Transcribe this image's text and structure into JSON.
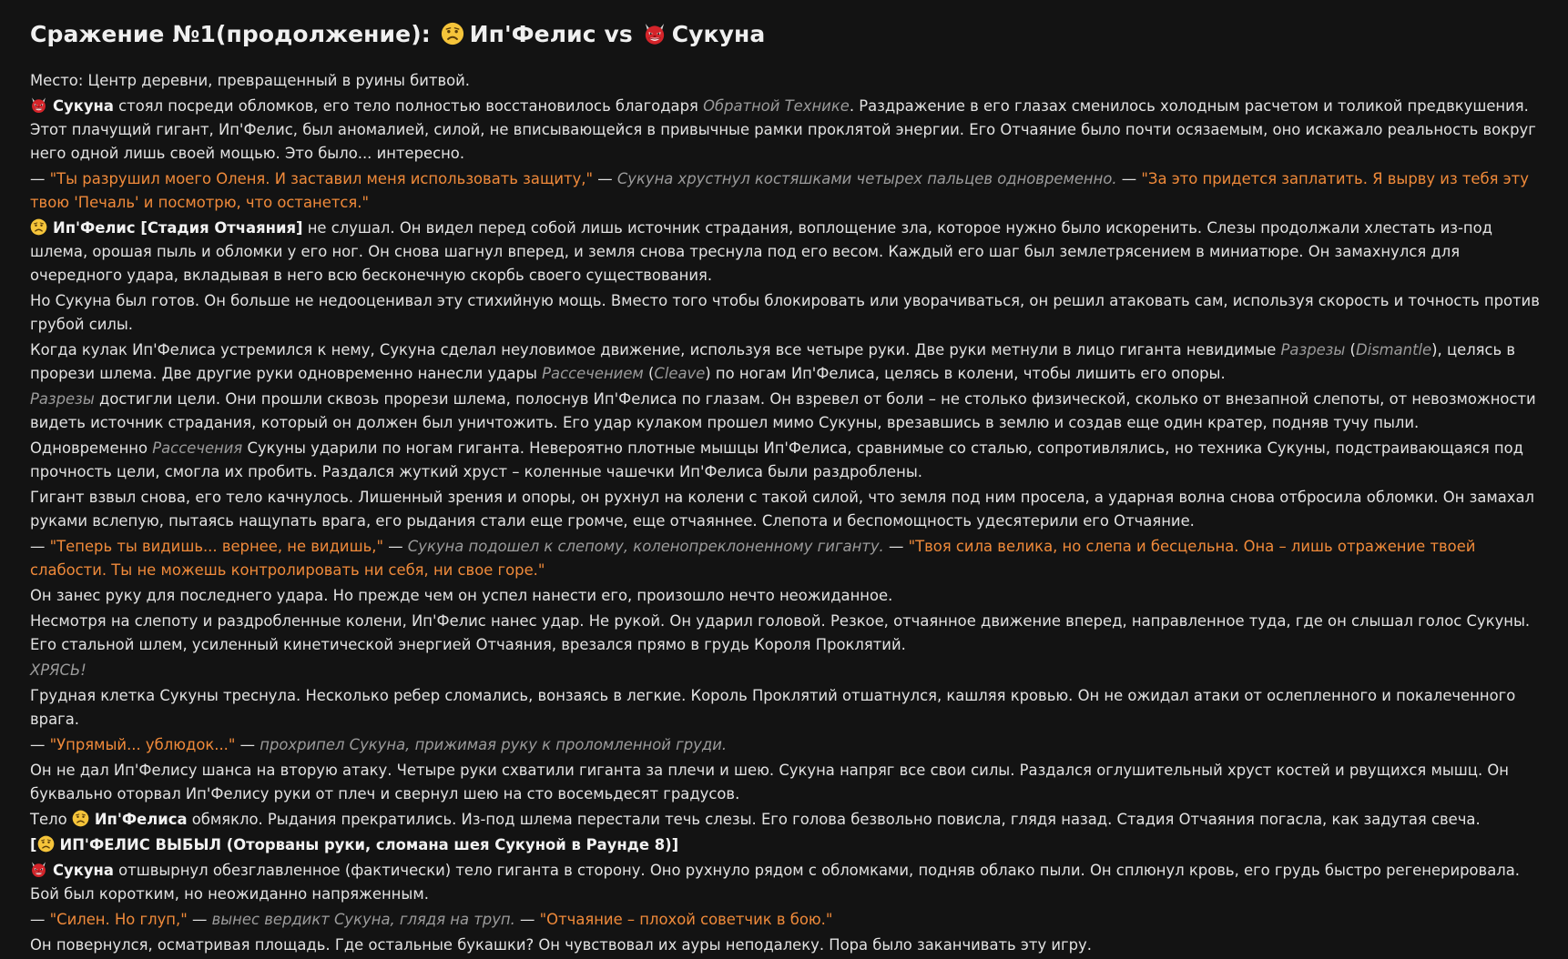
{
  "title": {
    "prefix": "Сражение №1(продолжение):",
    "fighter1": "Ип'Фелис vs",
    "fighter2": "Сукуна"
  },
  "p1": "Место: Центр деревни, превращенный в руины битвой.",
  "p2": {
    "name": "Сукуна",
    "t1": " стоял посреди обломков, его тело полностью восстановилось благодаря ",
    "tech": "Обратной Технике",
    "t2": ". Раздражение в его глазах сменилось холодным расчетом и толикой предвкушения. Этот плачущий гигант, Ип'Фелис, был аномалией, силой, не вписывающейся в привычные рамки проклятой энергии. Его Отчаяние было почти осязаемым, оно искажало реальность вокруг него одной лишь своей мощью. Это было... интересно."
  },
  "p3": {
    "d1": "— ",
    "q1": "\"Ты разрушил моего Оленя. И заставил меня использовать защиту,\"",
    "d2": " — ",
    "narr": "Сукуна хрустнул костяшками четырех пальцев одновременно.",
    "d3": " — ",
    "q2": "\"За это придется заплатить. Я вырву из тебя эту твою 'Печаль' и посмотрю, что останется.\""
  },
  "p4": {
    "name": "Ип'Фелис [Стадия Отчаяния]",
    "t": " не слушал. Он видел перед собой лишь источник страдания, воплощение зла, которое нужно было искоренить. Слезы продолжали хлестать из-под шлема, орошая пыль и обломки у его ног. Он снова шагнул вперед, и земля снова треснула под его весом. Каждый его шаг был землетрясением в миниатюре. Он замахнулся для очередного удара, вкладывая в него всю бесконечную скорбь своего существования."
  },
  "p5": "Но Сукуна был готов. Он больше не недооценивал эту стихийную мощь. Вместо того чтобы блокировать или уворачиваться, он решил атаковать сам, используя скорость и точность против грубой силы.",
  "p6": {
    "t1": "Когда кулак Ип'Фелиса устремился к нему, Сукуна сделал неуловимое движение, используя все четыре руки. Две руки метнули в лицо гиганта невидимые ",
    "i1": "Разрезы",
    "t2": " (",
    "i2": "Dismantle",
    "t3": "), целясь в прорези шлема. Две другие руки одновременно нанесли удары ",
    "i3": "Рассечением",
    "t4": " (",
    "i4": "Cleave",
    "t5": ") по ногам Ип'Фелиса, целясь в колени, чтобы лишить его опоры."
  },
  "p7": {
    "i1": "Разрезы",
    "t": " достигли цели. Они прошли сквозь прорези шлема, полоснув Ип'Фелиса по глазам. Он взревел от боли – не столько физической, сколько от внезапной слепоты, от невозможности видеть источник страдания, который он должен был уничтожить. Его удар кулаком прошел мимо Сукуны, врезавшись в землю и создав еще один кратер, подняв тучу пыли."
  },
  "p8": {
    "t1": "Одновременно ",
    "i1": "Рассечения",
    "t2": " Сукуны ударили по ногам гиганта. Невероятно плотные мышцы Ип'Фелиса, сравнимые со сталью, сопротивлялись, но техника Сукуны, подстраивающаяся под прочность цели, смогла их пробить. Раздался жуткий хруст – коленные чашечки Ип'Фелиса были раздроблены."
  },
  "p9": "Гигант взвыл снова, его тело качнулось. Лишенный зрения и опоры, он рухнул на колени с такой силой, что земля под ним просела, а ударная волна снова отбросила обломки. Он замахал руками вслепую, пытаясь нащупать врага, его рыдания стали еще громче, еще отчаяннее. Слепота и беспомощность удесятерили его Отчаяние.",
  "p10": {
    "d1": "— ",
    "q1": "\"Теперь ты видишь... вернее, не видишь,\"",
    "d2": " — ",
    "narr": "Сукуна подошел к слепому, коленопреклоненному гиганту.",
    "d3": " — ",
    "q2": "\"Твоя сила велика, но слепа и бесцельна. Она – лишь отражение твоей слабости. Ты не можешь контролировать ни себя, ни свое горе.\""
  },
  "p11": "Он занес руку для последнего удара. Но прежде чем он успел нанести его, произошло нечто неожиданное.",
  "p12": "Несмотря на слепоту и раздробленные колени, Ип'Фелис нанес удар. Не рукой. Он ударил головой. Резкое, отчаянное движение вперед, направленное туда, где он слышал голос Сукуны. Его стальной шлем, усиленный кинетической энергией Отчаяния, врезался прямо в грудь Короля Проклятий.",
  "p13": "ХРЯСЬ!",
  "p14": "Грудная клетка Сукуны треснула. Несколько ребер сломались, вонзаясь в легкие. Король Проклятий отшатнулся, кашляя кровью. Он не ожидал атаки от ослепленного и покалеченного врага.",
  "p15": {
    "d1": "— ",
    "q1": "\"Упрямый... ублюдок...\"",
    "d2": " — ",
    "narr": "прохрипел Сукуна, прижимая руку к проломленной груди."
  },
  "p16": "Он не дал Ип'Фелису шанса на вторую атаку. Четыре руки схватили гиганта за плечи и шею. Сукуна напряг все свои силы. Раздался оглушительный хруст костей и рвущихся мышц. Он буквально оторвал Ип'Фелису руки от плеч и свернул шею на сто восемьдесят градусов.",
  "p17": {
    "t1": "Тело ",
    "name": "Ип'Фелиса",
    "t2": " обмякло. Рыдания прекратились. Из-под шлема перестали течь слезы. Его голова безвольно повисла, глядя назад. Стадия Отчаяния погасла, как задутая свеча."
  },
  "p18": {
    "open": "[",
    "text": "ИП'ФЕЛИС ВЫБЫЛ (Оторваны руки, сломана шея Сукуной в Раунде 8)]"
  },
  "p19": {
    "name": "Сукуна",
    "t": " отшвырнул обезглавленное (фактически) тело гиганта в сторону. Оно рухнуло рядом с обломками, подняв облако пыли. Он сплюнул кровь, его грудь быстро регенерировала. Бой был коротким, но неожиданно напряженным."
  },
  "p20": {
    "d1": "— ",
    "q1": "\"Силен. Но глуп,\"",
    "d2": " — ",
    "narr": "вынес вердикт Сукуна, глядя на труп.",
    "d3": " — ",
    "q2": "\"Отчаяние – плохой советчик в бою.\""
  },
  "p21": "Он повернулся, осматривая площадь. Где остальные букашки? Он чувствовал их ауры неподалеку. Пора было заканчивать эту игру.",
  "icons": {
    "sad": "sad-face-icon",
    "demon": "red-demon-icon"
  }
}
